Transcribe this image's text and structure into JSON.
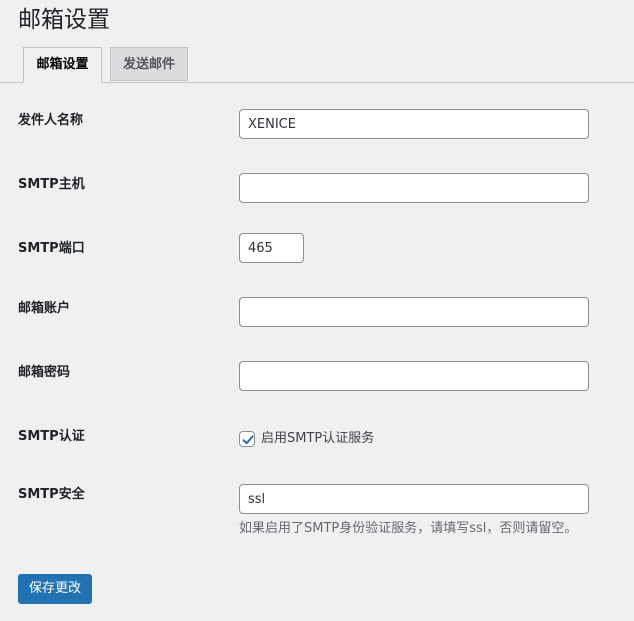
{
  "page": {
    "title": "邮箱设置"
  },
  "tabs": [
    {
      "label": "邮箱设置",
      "active": true
    },
    {
      "label": "发送邮件",
      "active": false
    }
  ],
  "fields": {
    "sender_name": {
      "label": "发件人名称",
      "value": "XENICE"
    },
    "smtp_host": {
      "label": "SMTP主机",
      "value": ""
    },
    "smtp_port": {
      "label": "SMTP端口",
      "value": "465"
    },
    "mail_account": {
      "label": "邮箱账户",
      "value": ""
    },
    "mail_password": {
      "label": "邮箱密码",
      "value": ""
    },
    "smtp_auth": {
      "label": "SMTP认证",
      "checkbox_label": "启用SMTP认证服务",
      "checked": true
    },
    "smtp_security": {
      "label": "SMTP安全",
      "value": "ssl",
      "description": "如果启用了SMTP身份验证服务，请填写ssl，否则请留空。"
    }
  },
  "actions": {
    "save_label": "保存更改"
  },
  "colors": {
    "accent": "#2271b1",
    "background": "#f0f0f1"
  }
}
